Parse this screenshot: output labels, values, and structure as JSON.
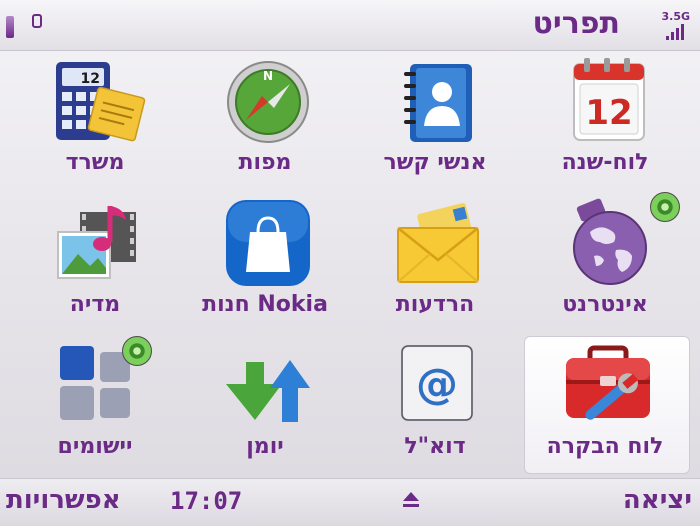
{
  "titlebar": {
    "title": "תפריט",
    "signal_label": "3.5G"
  },
  "grid": {
    "items": [
      {
        "label": "לוח-שנה",
        "icon": "calendar-icon",
        "calendar_day": "12"
      },
      {
        "label": "אנשי קשר",
        "icon": "contacts-icon"
      },
      {
        "label": "מפות",
        "icon": "compass-icon",
        "compass_letter": "N"
      },
      {
        "label": "משרד",
        "icon": "office-calculator-icon",
        "calculator_display": "12"
      },
      {
        "label": "אינטרנט",
        "icon": "internet-globe-icon"
      },
      {
        "label": "הרדעות",
        "icon": "messaging-envelope-icon"
      },
      {
        "label": "חנות Nokia",
        "icon": "nokia-store-bag-icon"
      },
      {
        "label": "מדיה",
        "icon": "media-icon"
      },
      {
        "label": "לוח הבקרה",
        "icon": "control-panel-toolbox-icon",
        "selected": true
      },
      {
        "label": "דוא\"ל",
        "icon": "email-at-icon",
        "at_symbol": "@"
      },
      {
        "label": "יומן",
        "icon": "log-arrows-icon"
      },
      {
        "label": "יישומים",
        "icon": "applications-grid-icon"
      }
    ]
  },
  "softkeys": {
    "left": "אפשרויות",
    "time": "17:07",
    "right": "יציאה"
  },
  "colors": {
    "accent": "#6a2a86",
    "selected_bg": "#ffffff"
  }
}
